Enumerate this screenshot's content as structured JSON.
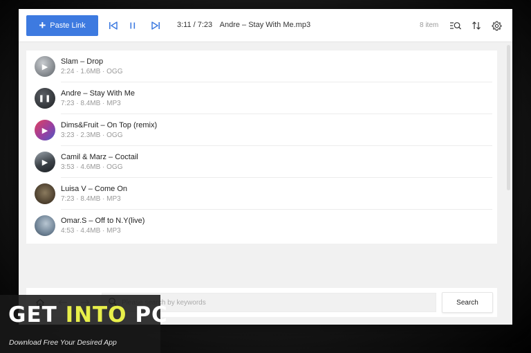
{
  "toolbar": {
    "paste_label": "Paste Link",
    "current_time": "3:11 / 7:23",
    "current_track": "Andre – Stay With Me.mp3",
    "item_count": "8 item",
    "accent_color": "#3d7ae0"
  },
  "tracks": [
    {
      "title": "Slam – Drop",
      "meta": "2:24 · 1.6MB · OGG",
      "state": "play",
      "color": "#8a8f94"
    },
    {
      "title": "Andre – Stay With Me",
      "meta": "7:23 · 8.4MB · MP3",
      "state": "pause",
      "color": "#3a3d42"
    },
    {
      "title": "Dims&Fruit – On Top (remix)",
      "meta": "3:23 · 2.3MB · OGG",
      "state": "play",
      "color": "#c0306a"
    },
    {
      "title": "Camil & Marz – Coctail",
      "meta": "3:53 · 4.6MB · OGG",
      "state": "play",
      "color": "#4a4f56"
    },
    {
      "title": "Luisa V – Come On",
      "meta": "7:23 · 8.4MB · MP3",
      "state": "none",
      "color": "#6b5a44"
    },
    {
      "title": "Omar.S – Off to N.Y(live)",
      "meta": "4:53 · 4.4MB · MP3",
      "state": "none",
      "color": "#5d6f80"
    }
  ],
  "search": {
    "placeholder": "Please search by keywords",
    "button_label": "Search"
  },
  "watermark": {
    "logo_part1": "GET ",
    "logo_part2": "INTO",
    "logo_part3": " PC",
    "tagline": "Download Free Your Desired App"
  }
}
